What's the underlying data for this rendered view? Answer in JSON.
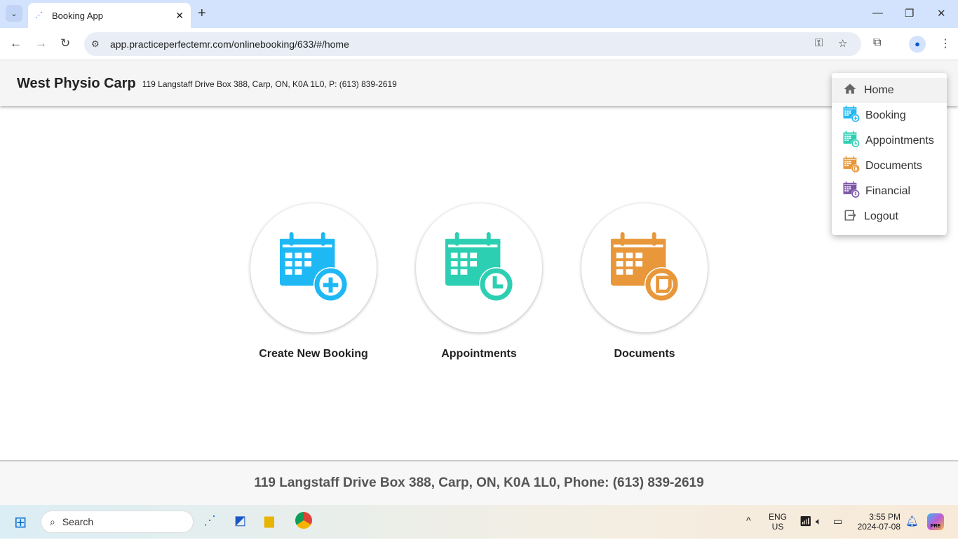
{
  "browser": {
    "tab_title": "Booking App",
    "url": "app.practiceperfectemr.com/onlinebooking/633/#/home"
  },
  "header": {
    "clinic_name": "West Physio Carp",
    "address": "119 Langstaff Drive Box 388, Carp, ON,  K0A 1L0,  P: (613) 839-2619"
  },
  "menu": {
    "items": [
      {
        "label": "Home",
        "icon": "home-icon",
        "active": true
      },
      {
        "label": "Booking",
        "icon": "calendar-plus-icon",
        "color": "#1eb8f5"
      },
      {
        "label": "Appointments",
        "icon": "calendar-clock-icon",
        "color": "#2dcfb2"
      },
      {
        "label": "Documents",
        "icon": "calendar-document-icon",
        "color": "#e8973a"
      },
      {
        "label": "Financial",
        "icon": "calendar-dollar-icon",
        "color": "#7b55a8"
      },
      {
        "label": "Logout",
        "icon": "logout-icon"
      }
    ]
  },
  "cards": [
    {
      "label": "Create New Booking",
      "icon": "calendar-plus-icon",
      "color": "#1eb8f5"
    },
    {
      "label": "Appointments",
      "icon": "calendar-clock-icon",
      "color": "#2dcfb2"
    },
    {
      "label": "Documents",
      "icon": "calendar-document-icon",
      "color": "#e8973a"
    }
  ],
  "footer": {
    "text": "119 Langstaff Drive Box 388, Carp, ON,  K0A 1L0,  Phone: (613) 839-2619"
  },
  "taskbar": {
    "search_placeholder": "Search",
    "lang_top": "ENG",
    "lang_bottom": "US",
    "time": "3:55 PM",
    "date": "2024-07-08",
    "copilot_badge": "PRE"
  }
}
